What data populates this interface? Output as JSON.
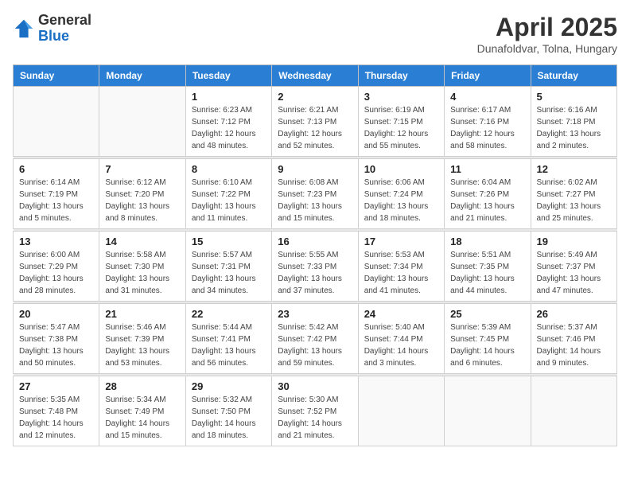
{
  "header": {
    "logo_general": "General",
    "logo_blue": "Blue",
    "title": "April 2025",
    "location": "Dunafoldvar, Tolna, Hungary"
  },
  "days_of_week": [
    "Sunday",
    "Monday",
    "Tuesday",
    "Wednesday",
    "Thursday",
    "Friday",
    "Saturday"
  ],
  "weeks": [
    [
      {
        "day": "",
        "sunrise": "",
        "sunset": "",
        "daylight": ""
      },
      {
        "day": "",
        "sunrise": "",
        "sunset": "",
        "daylight": ""
      },
      {
        "day": "1",
        "sunrise": "Sunrise: 6:23 AM",
        "sunset": "Sunset: 7:12 PM",
        "daylight": "Daylight: 12 hours and 48 minutes."
      },
      {
        "day": "2",
        "sunrise": "Sunrise: 6:21 AM",
        "sunset": "Sunset: 7:13 PM",
        "daylight": "Daylight: 12 hours and 52 minutes."
      },
      {
        "day": "3",
        "sunrise": "Sunrise: 6:19 AM",
        "sunset": "Sunset: 7:15 PM",
        "daylight": "Daylight: 12 hours and 55 minutes."
      },
      {
        "day": "4",
        "sunrise": "Sunrise: 6:17 AM",
        "sunset": "Sunset: 7:16 PM",
        "daylight": "Daylight: 12 hours and 58 minutes."
      },
      {
        "day": "5",
        "sunrise": "Sunrise: 6:16 AM",
        "sunset": "Sunset: 7:18 PM",
        "daylight": "Daylight: 13 hours and 2 minutes."
      }
    ],
    [
      {
        "day": "6",
        "sunrise": "Sunrise: 6:14 AM",
        "sunset": "Sunset: 7:19 PM",
        "daylight": "Daylight: 13 hours and 5 minutes."
      },
      {
        "day": "7",
        "sunrise": "Sunrise: 6:12 AM",
        "sunset": "Sunset: 7:20 PM",
        "daylight": "Daylight: 13 hours and 8 minutes."
      },
      {
        "day": "8",
        "sunrise": "Sunrise: 6:10 AM",
        "sunset": "Sunset: 7:22 PM",
        "daylight": "Daylight: 13 hours and 11 minutes."
      },
      {
        "day": "9",
        "sunrise": "Sunrise: 6:08 AM",
        "sunset": "Sunset: 7:23 PM",
        "daylight": "Daylight: 13 hours and 15 minutes."
      },
      {
        "day": "10",
        "sunrise": "Sunrise: 6:06 AM",
        "sunset": "Sunset: 7:24 PM",
        "daylight": "Daylight: 13 hours and 18 minutes."
      },
      {
        "day": "11",
        "sunrise": "Sunrise: 6:04 AM",
        "sunset": "Sunset: 7:26 PM",
        "daylight": "Daylight: 13 hours and 21 minutes."
      },
      {
        "day": "12",
        "sunrise": "Sunrise: 6:02 AM",
        "sunset": "Sunset: 7:27 PM",
        "daylight": "Daylight: 13 hours and 25 minutes."
      }
    ],
    [
      {
        "day": "13",
        "sunrise": "Sunrise: 6:00 AM",
        "sunset": "Sunset: 7:29 PM",
        "daylight": "Daylight: 13 hours and 28 minutes."
      },
      {
        "day": "14",
        "sunrise": "Sunrise: 5:58 AM",
        "sunset": "Sunset: 7:30 PM",
        "daylight": "Daylight: 13 hours and 31 minutes."
      },
      {
        "day": "15",
        "sunrise": "Sunrise: 5:57 AM",
        "sunset": "Sunset: 7:31 PM",
        "daylight": "Daylight: 13 hours and 34 minutes."
      },
      {
        "day": "16",
        "sunrise": "Sunrise: 5:55 AM",
        "sunset": "Sunset: 7:33 PM",
        "daylight": "Daylight: 13 hours and 37 minutes."
      },
      {
        "day": "17",
        "sunrise": "Sunrise: 5:53 AM",
        "sunset": "Sunset: 7:34 PM",
        "daylight": "Daylight: 13 hours and 41 minutes."
      },
      {
        "day": "18",
        "sunrise": "Sunrise: 5:51 AM",
        "sunset": "Sunset: 7:35 PM",
        "daylight": "Daylight: 13 hours and 44 minutes."
      },
      {
        "day": "19",
        "sunrise": "Sunrise: 5:49 AM",
        "sunset": "Sunset: 7:37 PM",
        "daylight": "Daylight: 13 hours and 47 minutes."
      }
    ],
    [
      {
        "day": "20",
        "sunrise": "Sunrise: 5:47 AM",
        "sunset": "Sunset: 7:38 PM",
        "daylight": "Daylight: 13 hours and 50 minutes."
      },
      {
        "day": "21",
        "sunrise": "Sunrise: 5:46 AM",
        "sunset": "Sunset: 7:39 PM",
        "daylight": "Daylight: 13 hours and 53 minutes."
      },
      {
        "day": "22",
        "sunrise": "Sunrise: 5:44 AM",
        "sunset": "Sunset: 7:41 PM",
        "daylight": "Daylight: 13 hours and 56 minutes."
      },
      {
        "day": "23",
        "sunrise": "Sunrise: 5:42 AM",
        "sunset": "Sunset: 7:42 PM",
        "daylight": "Daylight: 13 hours and 59 minutes."
      },
      {
        "day": "24",
        "sunrise": "Sunrise: 5:40 AM",
        "sunset": "Sunset: 7:44 PM",
        "daylight": "Daylight: 14 hours and 3 minutes."
      },
      {
        "day": "25",
        "sunrise": "Sunrise: 5:39 AM",
        "sunset": "Sunset: 7:45 PM",
        "daylight": "Daylight: 14 hours and 6 minutes."
      },
      {
        "day": "26",
        "sunrise": "Sunrise: 5:37 AM",
        "sunset": "Sunset: 7:46 PM",
        "daylight": "Daylight: 14 hours and 9 minutes."
      }
    ],
    [
      {
        "day": "27",
        "sunrise": "Sunrise: 5:35 AM",
        "sunset": "Sunset: 7:48 PM",
        "daylight": "Daylight: 14 hours and 12 minutes."
      },
      {
        "day": "28",
        "sunrise": "Sunrise: 5:34 AM",
        "sunset": "Sunset: 7:49 PM",
        "daylight": "Daylight: 14 hours and 15 minutes."
      },
      {
        "day": "29",
        "sunrise": "Sunrise: 5:32 AM",
        "sunset": "Sunset: 7:50 PM",
        "daylight": "Daylight: 14 hours and 18 minutes."
      },
      {
        "day": "30",
        "sunrise": "Sunrise: 5:30 AM",
        "sunset": "Sunset: 7:52 PM",
        "daylight": "Daylight: 14 hours and 21 minutes."
      },
      {
        "day": "",
        "sunrise": "",
        "sunset": "",
        "daylight": ""
      },
      {
        "day": "",
        "sunrise": "",
        "sunset": "",
        "daylight": ""
      },
      {
        "day": "",
        "sunrise": "",
        "sunset": "",
        "daylight": ""
      }
    ]
  ]
}
